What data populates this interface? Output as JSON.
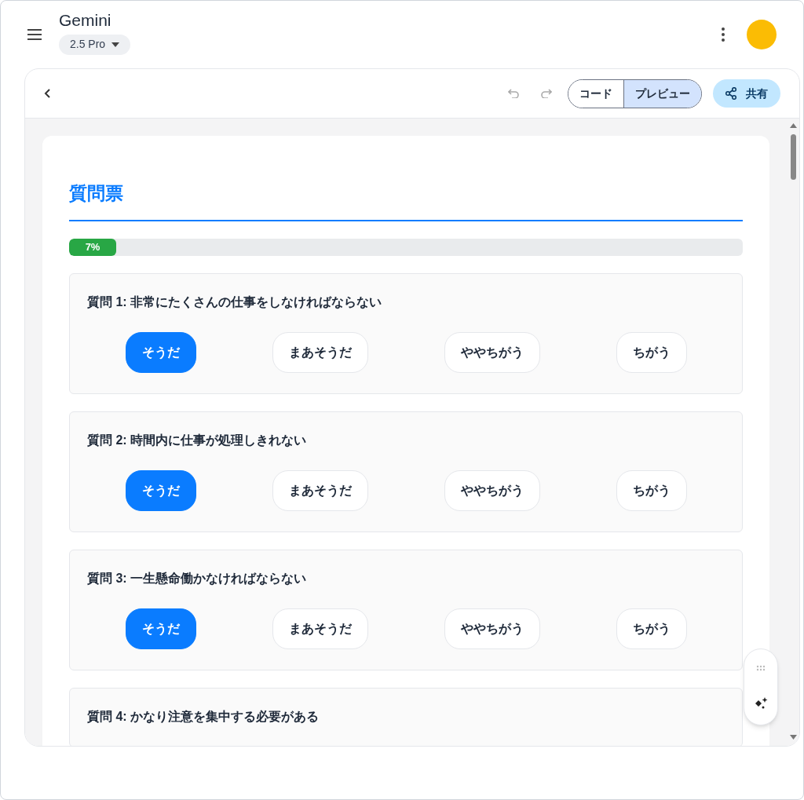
{
  "app": {
    "title": "Gemini",
    "model": "2.5 Pro"
  },
  "toolbar": {
    "view_tabs": [
      {
        "label": "コード",
        "selected": false
      },
      {
        "label": "プレビュー",
        "selected": true
      }
    ],
    "share": "共有"
  },
  "form": {
    "title": "質問票",
    "progress": {
      "level": 0.07,
      "label": "7%"
    },
    "questions": [
      {
        "text": "質問 1: 非常にたくさんの仕事をしなければならない",
        "options": [
          {
            "label": "そうだ",
            "selected": true
          },
          {
            "label": "まあそうだ",
            "selected": false
          },
          {
            "label": "ややちがう",
            "selected": false
          },
          {
            "label": "ちがう",
            "selected": false
          }
        ]
      },
      {
        "text": "質問 2: 時間内に仕事が処理しきれない",
        "options": [
          {
            "label": "そうだ",
            "selected": true
          },
          {
            "label": "まあそうだ",
            "selected": false
          },
          {
            "label": "ややちがう",
            "selected": false
          },
          {
            "label": "ちがう",
            "selected": false
          }
        ]
      },
      {
        "text": "質問 3: 一生懸命働かなければならない",
        "options": [
          {
            "label": "そうだ",
            "selected": true
          },
          {
            "label": "まあそうだ",
            "selected": false
          },
          {
            "label": "ややちがう",
            "selected": false
          },
          {
            "label": "ちがう",
            "selected": false
          }
        ]
      },
      {
        "text": "質問 4: かなり注意を集中する必要がある"
      }
    ]
  }
}
